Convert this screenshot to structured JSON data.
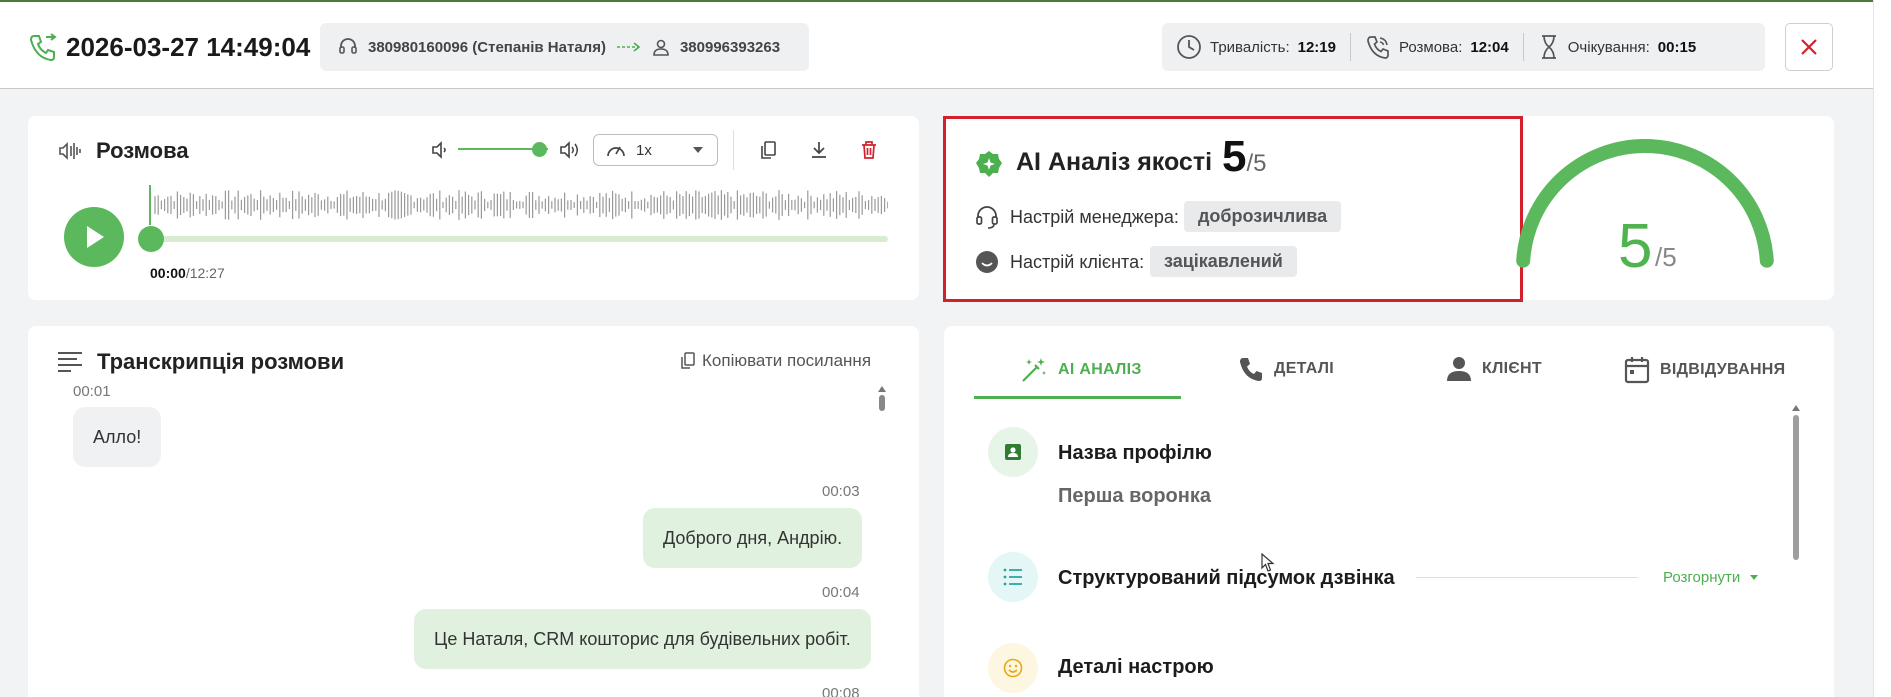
{
  "header": {
    "datetime": "2026-03-27 14:49:04",
    "caller": "380980160096 (Степанів Наталя)",
    "callee": "380996393263",
    "stats": [
      {
        "label": "Тривалість:",
        "value": "12:19"
      },
      {
        "label": "Розмова:",
        "value": "12:04"
      },
      {
        "label": "Очікування:",
        "value": "00:15"
      }
    ]
  },
  "player": {
    "title": "Розмова",
    "current_time": "00:00",
    "total_time": "/12:27",
    "speed": "1x",
    "volume_level": 0.9,
    "progress": 0
  },
  "ai": {
    "title": "AI Аналіз якості",
    "score": "5",
    "score_max": "/5",
    "manager_mood_label": "Настрій менеджера:",
    "manager_mood": "доброзичлива",
    "client_mood_label": "Настрій клієнта:",
    "client_mood": "зацікавлений",
    "gauge_value": "5",
    "gauge_max": "/5",
    "gauge_fraction": 1.0
  },
  "transcript": {
    "title": "Транскрипція розмови",
    "copy_link": "Копіювати посилання",
    "messages": [
      {
        "time": "00:01",
        "text": "Алло!",
        "side": "in"
      },
      {
        "time": "00:03",
        "text": "Доброго дня, Андрію.",
        "side": "out"
      },
      {
        "time": "00:04",
        "text": "Це Наталя, CRM кошторис для будівельних робіт.",
        "side": "out"
      },
      {
        "time": "00:08",
        "text": "",
        "side": "out"
      }
    ]
  },
  "tabs": [
    {
      "label": "AI АНАЛІЗ",
      "active": true
    },
    {
      "label": "ДЕТАЛІ",
      "active": false
    },
    {
      "label": "КЛІЄНТ",
      "active": false
    },
    {
      "label": "ВІДВІДУВАННЯ",
      "active": false
    }
  ],
  "sections": {
    "profile_title": "Назва профілю",
    "profile_value": "Перша воронка",
    "summary_title": "Структурований підсумок дзвінка",
    "expand_label": "Розгорнути",
    "mood_title": "Деталі настрою"
  },
  "colors": {
    "accent": "#4caf50",
    "highlight_border": "#d3202a",
    "close": "#d3202a"
  }
}
